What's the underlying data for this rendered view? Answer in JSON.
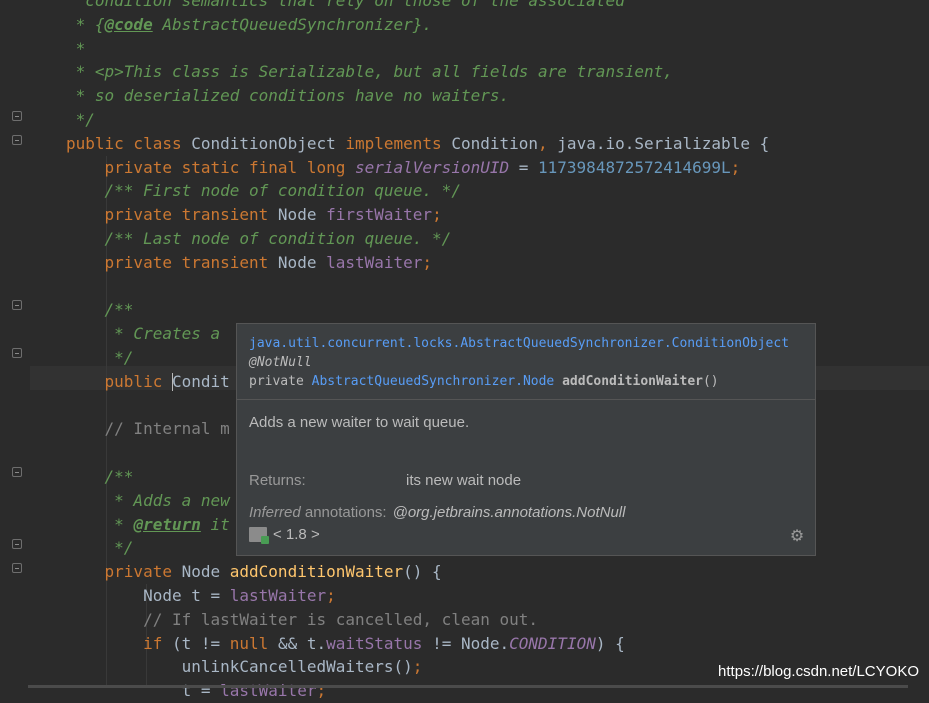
{
  "editor": {
    "lines": [
      {
        "segs": [
          [
            "cmt",
            "  condition semantics that rely on those of the associated"
          ]
        ]
      },
      {
        "segs": [
          [
            "cmt",
            " * {"
          ],
          [
            "tag",
            "@code"
          ],
          [
            "cmt",
            " AbstractQueuedSynchronizer}."
          ]
        ]
      },
      {
        "segs": [
          [
            "cmt",
            " *"
          ]
        ]
      },
      {
        "segs": [
          [
            "cmt",
            " * <p>This class is Serializable, but all fields are transient,"
          ]
        ]
      },
      {
        "segs": [
          [
            "cmt",
            " * so deserialized conditions have no waiters."
          ]
        ]
      },
      {
        "segs": [
          [
            "cmt",
            " */"
          ]
        ]
      },
      {
        "segs": [
          [
            "kw",
            "public class "
          ],
          [
            "plain",
            "ConditionObject "
          ],
          [
            "kw",
            "implements "
          ],
          [
            "plain",
            "Condition"
          ],
          [
            "kw",
            ", "
          ],
          [
            "plain",
            "java.io.Serializable {"
          ]
        ]
      },
      {
        "segs": [
          [
            "kw",
            "    private static final long "
          ],
          [
            "fieldi",
            "serialVersionUID"
          ],
          [
            "plain",
            " = "
          ],
          [
            "num",
            "1173984872572414699L"
          ],
          [
            "kw",
            ";"
          ]
        ]
      },
      {
        "segs": [
          [
            "cmt",
            "    /** First node of condition queue. */"
          ]
        ]
      },
      {
        "segs": [
          [
            "kw",
            "    private transient "
          ],
          [
            "plain",
            "Node "
          ],
          [
            "field",
            "firstWaiter"
          ],
          [
            "kw",
            ";"
          ]
        ]
      },
      {
        "segs": [
          [
            "cmt",
            "    /** Last node of condition queue. */"
          ]
        ]
      },
      {
        "segs": [
          [
            "kw",
            "    private transient "
          ],
          [
            "plain",
            "Node "
          ],
          [
            "field",
            "lastWaiter"
          ],
          [
            "kw",
            ";"
          ]
        ]
      },
      {
        "segs": [
          [
            "plain",
            ""
          ]
        ]
      },
      {
        "segs": [
          [
            "cmt",
            "    /**"
          ]
        ]
      },
      {
        "segs": [
          [
            "cmt",
            "     * Creates a"
          ]
        ]
      },
      {
        "segs": [
          [
            "cmt",
            "     */"
          ]
        ]
      },
      {
        "segs": [
          [
            "kw",
            "    public "
          ],
          [
            "caret",
            ""
          ],
          [
            "plain",
            "Condit"
          ]
        ]
      },
      {
        "segs": [
          [
            "plain",
            ""
          ]
        ]
      },
      {
        "segs": [
          [
            "cmt2",
            "    // Internal m"
          ]
        ]
      },
      {
        "segs": [
          [
            "plain",
            ""
          ]
        ]
      },
      {
        "segs": [
          [
            "cmt",
            "    /**"
          ]
        ]
      },
      {
        "segs": [
          [
            "cmt",
            "     * Adds a new"
          ]
        ]
      },
      {
        "segs": [
          [
            "cmt",
            "     * "
          ],
          [
            "tag",
            "@return"
          ],
          [
            "cmt",
            " it"
          ]
        ]
      },
      {
        "segs": [
          [
            "cmt",
            "     */"
          ]
        ]
      },
      {
        "segs": [
          [
            "kw",
            "    private "
          ],
          [
            "plain",
            "Node "
          ],
          [
            "fn",
            "addConditionWaiter"
          ],
          [
            "plain",
            "() {"
          ]
        ]
      },
      {
        "segs": [
          [
            "plain",
            "        Node t = "
          ],
          [
            "field",
            "lastWaiter"
          ],
          [
            "kw",
            ";"
          ]
        ]
      },
      {
        "segs": [
          [
            "cmt2",
            "        // If lastWaiter is cancelled, clean out."
          ]
        ]
      },
      {
        "segs": [
          [
            "kw",
            "        if "
          ],
          [
            "plain",
            "(t != "
          ],
          [
            "kw",
            "null "
          ],
          [
            "plain",
            "&& t."
          ],
          [
            "field",
            "waitStatus"
          ],
          [
            "plain",
            " != Node."
          ],
          [
            "fieldi",
            "CONDITION"
          ],
          [
            "plain",
            ") {"
          ]
        ]
      },
      {
        "segs": [
          [
            "plain",
            "            unlinkCancelledWaiters()"
          ],
          [
            "kw",
            ";"
          ]
        ]
      },
      {
        "segs": [
          [
            "plain",
            "            t = "
          ],
          [
            "field",
            "lastWaiter"
          ],
          [
            "kw",
            ";"
          ]
        ]
      }
    ]
  },
  "popup": {
    "qualified_name": "java.util.concurrent.locks.AbstractQueuedSynchronizer.ConditionObject",
    "annotation": "@NotNull",
    "modifier": "private ",
    "return_type": "AbstractQueuedSynchronizer.Node",
    "method_sig": "addConditionWaiter",
    "params": "()",
    "description": "Adds a new waiter to wait queue.",
    "returns_label": "Returns:",
    "returns_value": "its new wait node",
    "inferred_label_italic": "Inferred",
    "inferred_label_rest": " annotations:",
    "inferred_value": "@org.jetbrains.annotations.NotNull",
    "jdk_version": "< 1.8 >"
  },
  "watermark": "https://blog.csdn.net/LCYOKO",
  "colors": {
    "background": "#2b2b2b",
    "keyword": "#cc7832",
    "comment": "#629755",
    "field": "#9876aa",
    "number": "#6897bb",
    "method": "#ffc66d",
    "link": "#589df6",
    "popup_bg": "#3c3f41"
  }
}
